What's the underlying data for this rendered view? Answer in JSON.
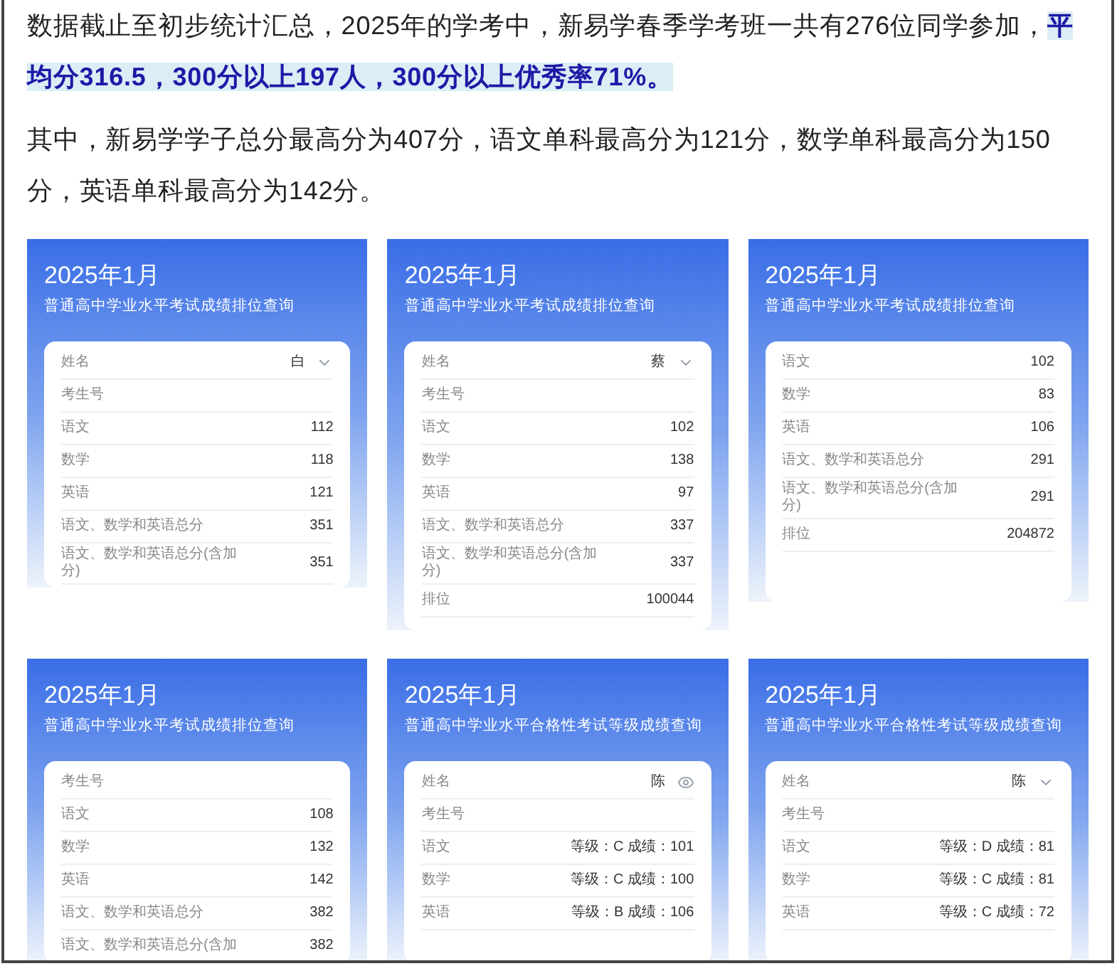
{
  "paragraphs": [
    "数据截止至初步统计汇总，2025年的学考中，新易学春季学考班一共有276位同学参加，**平均分316.5，300分以上197人，300分以上优秀率71%。**",
    "其中，新易学学子总分最高分为407分，语文单科最高分为121分，数学单科最高分为150分，英语单科最高分为142分。"
  ],
  "screenshots": [
    {
      "date": "2025年1月",
      "subtitle": "普通高中学业水平考试成绩排位查询",
      "rows": [
        {
          "label": "姓名",
          "value": "白",
          "kind": "dropdown"
        },
        {
          "label": "考生号"
        },
        {
          "label": "语文",
          "value": "112"
        },
        {
          "label": "数学",
          "value": "118"
        },
        {
          "label": "英语",
          "value": "121"
        },
        {
          "label": "语文、数学和英语总分",
          "value": "351"
        },
        {
          "label": "语文、数学和英语总分(含加分)",
          "value": "351"
        }
      ]
    },
    {
      "date": "2025年1月",
      "subtitle": "普通高中学业水平考试成绩排位查询",
      "rows": [
        {
          "label": "姓名",
          "value": "蔡",
          "kind": "dropdown"
        },
        {
          "label": "考生号"
        },
        {
          "label": "语文",
          "value": "102"
        },
        {
          "label": "数学",
          "value": "138"
        },
        {
          "label": "英语",
          "value": "97"
        },
        {
          "label": "语文、数学和英语总分",
          "value": "337"
        },
        {
          "label": "语文、数学和英语总分(含加分)",
          "value": "337"
        },
        {
          "label": "排位",
          "value": "100044"
        }
      ]
    },
    {
      "date": "2025年1月",
      "subtitle": "普通高中学业水平考试成绩排位查询",
      "rows": [
        {
          "label": "语文",
          "value": "102"
        },
        {
          "label": "数学",
          "value": "83"
        },
        {
          "label": "英语",
          "value": "106"
        },
        {
          "label": "语文、数学和英语总分",
          "value": "291"
        },
        {
          "label": "语文、数学和英语总分(含加分)",
          "value": "291"
        },
        {
          "label": "排位",
          "value": "204872"
        }
      ]
    },
    {
      "date": "2025年1月",
      "subtitle": "普通高中学业水平考试成绩排位查询",
      "rows": [
        {
          "label": "考生号"
        },
        {
          "label": "语文",
          "value": "108"
        },
        {
          "label": "数学",
          "value": "132"
        },
        {
          "label": "英语",
          "value": "142"
        },
        {
          "label": "语文、数学和英语总分",
          "value": "382"
        },
        {
          "label": "语文、数学和英语总分(含加",
          "value": "382"
        }
      ]
    },
    {
      "date": "2025年1月",
      "subtitle": "普通高中学业水平合格性考试等级成绩查询",
      "rows": [
        {
          "label": "姓名",
          "value": "陈",
          "kind": "reveal"
        },
        {
          "label": "考生号"
        },
        {
          "label": "语文",
          "value": "等级：C 成绩：101"
        },
        {
          "label": "数学",
          "value": "等级：C 成绩：100"
        },
        {
          "label": "英语",
          "value": "等级：B 成绩：106"
        }
      ]
    },
    {
      "date": "2025年1月",
      "subtitle": "普通高中学业水平合格性考试等级成绩查询",
      "rows": [
        {
          "label": "姓名",
          "value": "陈",
          "kind": "dropdown"
        },
        {
          "label": "考生号"
        },
        {
          "label": "语文",
          "value": "等级：D 成绩：81"
        },
        {
          "label": "数学",
          "value": "等级：C 成绩：81"
        },
        {
          "label": "英语",
          "value": "等级：C 成绩：72"
        }
      ]
    }
  ]
}
